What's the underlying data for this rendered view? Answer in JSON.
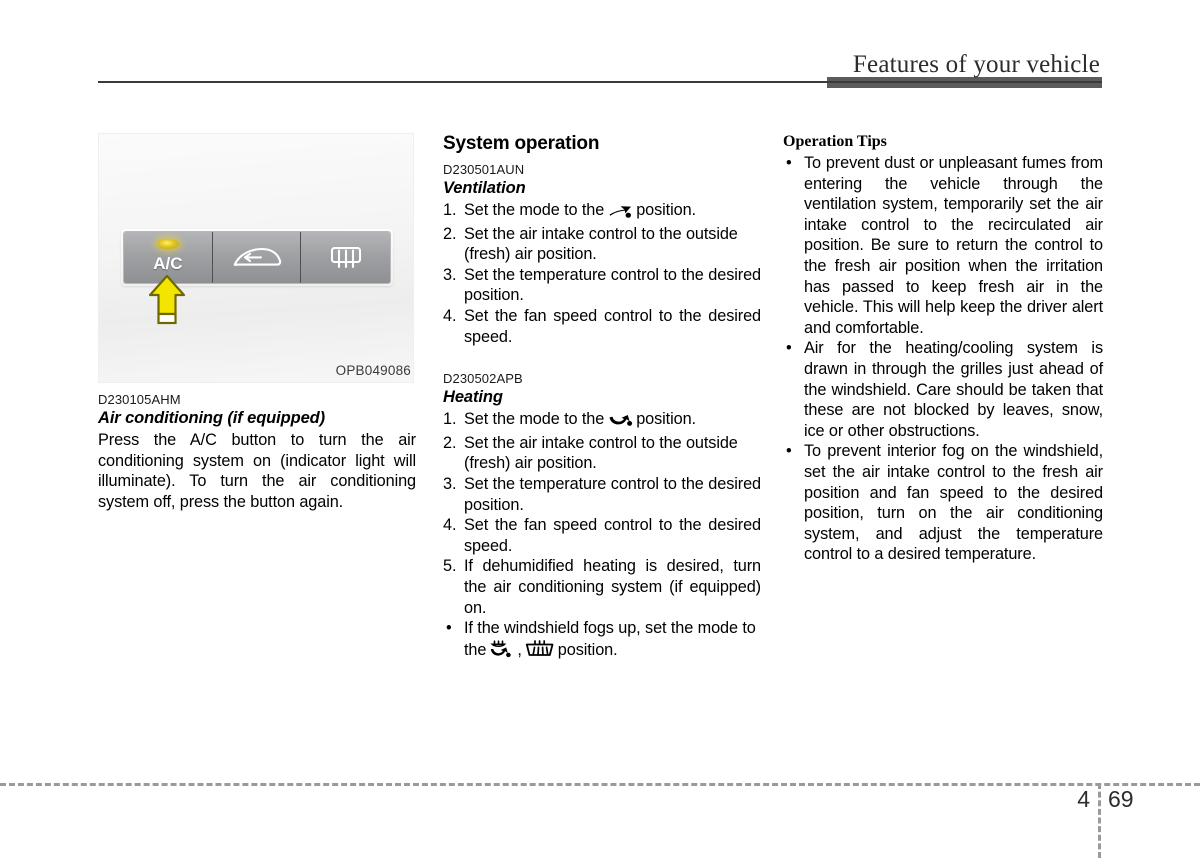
{
  "header": {
    "title": "Features of your vehicle"
  },
  "figure": {
    "code": "OPB049086",
    "buttons": [
      {
        "label": "A/C",
        "icon": "ac-indicator-led",
        "state": "on"
      },
      {
        "label": "",
        "icon": "air-recirculation-icon",
        "state": "off"
      },
      {
        "label": "",
        "icon": "rear-window-defroster-icon",
        "state": "off"
      }
    ],
    "callout": "arrow-pointing-at-ac-button"
  },
  "left_column": {
    "doc_code": "D230105AHM",
    "subhead": "Air conditioning (if equipped)",
    "body": "Press the A/C button to turn the air conditioning system on (indicator light will illuminate). To turn the air conditioning system off, press the button again."
  },
  "middle_column": {
    "section_head": "System operation",
    "ventilation": {
      "doc_code": "D230501AUN",
      "subhead": "Ventilation",
      "steps": [
        {
          "num": "1.",
          "pre": "Set the mode to the",
          "icon": "face-vent-mode-icon",
          "post": "position."
        },
        {
          "num": "2.",
          "text": "Set the air intake control to the outside (fresh) air position."
        },
        {
          "num": "3.",
          "text": "Set the temperature control to the desired position."
        },
        {
          "num": "4.",
          "text": "Set the fan speed control to the desired speed."
        }
      ]
    },
    "heating": {
      "doc_code": "D230502APB",
      "subhead": "Heating",
      "steps": [
        {
          "num": "1.",
          "pre": "Set the mode to the",
          "icon": "floor-vent-mode-icon",
          "post": "position."
        },
        {
          "num": "2.",
          "text": "Set the air intake control to the outside (fresh) air position."
        },
        {
          "num": "3.",
          "text": "Set the temperature control to the desired position."
        },
        {
          "num": "4.",
          "text": "Set the fan speed control to the desired speed."
        },
        {
          "num": "5.",
          "text": "If dehumidified heating is desired, turn the air conditioning system (if equipped) on."
        }
      ],
      "note": {
        "bullet": "•",
        "pre": "If the windshield fogs up, set the mode to the",
        "icon1": "floor-defrost-mode-icon",
        "separator": ",",
        "icon2": "windshield-defrost-mode-icon",
        "post": "position."
      }
    }
  },
  "right_column": {
    "heading": "Operation Tips",
    "tips": [
      "To prevent dust or unpleasant fumes from entering the vehicle through the ventilation system, temporarily set the air intake control to the recirculated air position. Be sure to return the control to the fresh air position  when the irritation has passed to keep fresh air in the vehicle. This will help keep the driver alert and comfortable.",
      "Air for the heating/cooling system is drawn in through the grilles just ahead of the windshield. Care should be taken that these are  not blocked by leaves, snow, ice or other obstructions.",
      "To prevent interior fog on the windshield, set the air intake control to the fresh air position and fan speed to the desired position, turn on the air conditioning system, and adjust the temperature control to a desired temperature."
    ],
    "bullet": "•"
  },
  "footer": {
    "chapter": "4",
    "page": "69"
  }
}
